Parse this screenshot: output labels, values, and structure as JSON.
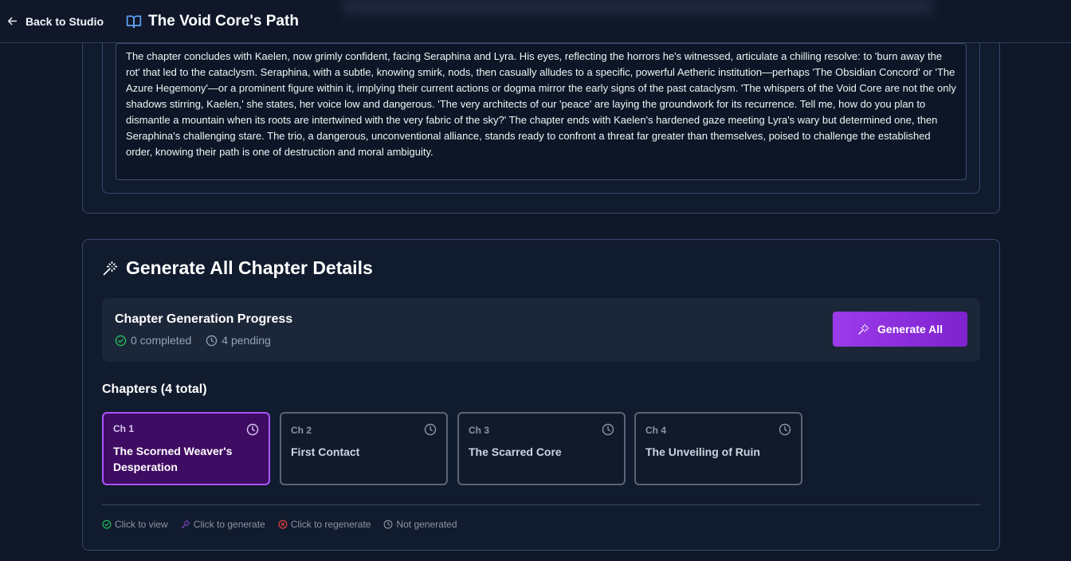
{
  "header": {
    "back_label": "Back to Studio",
    "title": "The Void Core's Path"
  },
  "summary": {
    "text": "The chapter concludes with Kaelen, now grimly confident, facing Seraphina and Lyra. His eyes, reflecting the horrors he's witnessed, articulate a chilling resolve: to 'burn away the rot' that led to the cataclysm. Seraphina, with a subtle, knowing smirk, nods, then casually alludes to a specific, powerful Aetheric institution—perhaps 'The Obsidian Concord' or 'The Azure Hegemony'—or a prominent figure within it, implying their current actions or dogma mirror the early signs of the past cataclysm. 'The whispers of the Void Core are not the only shadows stirring, Kaelen,' she states, her voice low and dangerous. 'The very architects of our 'peace' are laying the groundwork for its recurrence. Tell me, how do you plan to dismantle a mountain when its roots are intertwined with the very fabric of the sky?' The chapter ends with Kaelen's hardened gaze meeting Lyra's wary but determined one, then Seraphina's challenging stare. The trio, a dangerous, unconventional alliance, stands ready to confront a threat far greater than themselves, poised to challenge the established order, knowing their path is one of destruction and moral ambiguity."
  },
  "generate": {
    "title": "Generate All Chapter Details",
    "progress_title": "Chapter Generation Progress",
    "completed_label": "0 completed",
    "pending_label": "4 pending",
    "button_label": "Generate All",
    "chapters_heading": "Chapters (4 total)",
    "chapters": [
      {
        "num": "Ch 1",
        "title": "The Scorned Weaver's Desperation"
      },
      {
        "num": "Ch 2",
        "title": "First Contact"
      },
      {
        "num": "Ch 3",
        "title": "The Scarred Core"
      },
      {
        "num": "Ch 4",
        "title": "The Unveiling of Ruin"
      }
    ],
    "legend": {
      "view": "Click to view",
      "generate": "Click to generate",
      "regenerate": "Click to regenerate",
      "not_generated": "Not generated"
    }
  },
  "colors": {
    "background": "#0f1729",
    "accent": "#9333ea",
    "active_card": "#3f0c63",
    "success": "#22c55e",
    "error": "#ef4444"
  },
  "icons": {
    "back": "arrow-left-icon",
    "title": "book-open-icon",
    "generate": "magic-wand-icon",
    "completed": "check-circle-icon",
    "pending": "clock-icon"
  }
}
